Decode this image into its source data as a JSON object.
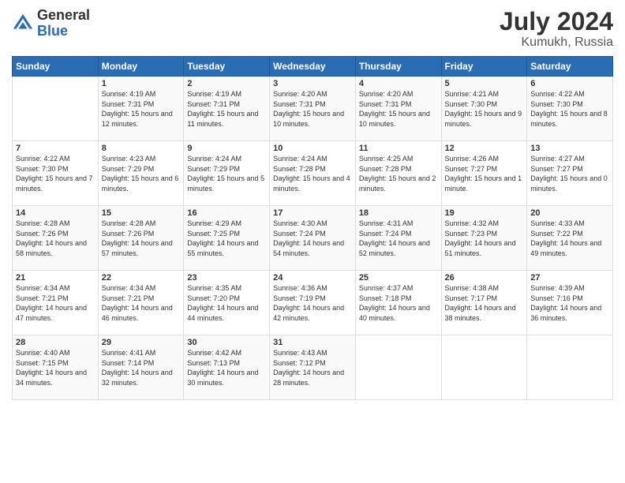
{
  "logo": {
    "general": "General",
    "blue": "Blue"
  },
  "title": {
    "month_year": "July 2024",
    "location": "Kumukh, Russia"
  },
  "headers": [
    "Sunday",
    "Monday",
    "Tuesday",
    "Wednesday",
    "Thursday",
    "Friday",
    "Saturday"
  ],
  "weeks": [
    [
      {
        "day": "",
        "sunrise": "",
        "sunset": "",
        "daylight": ""
      },
      {
        "day": "1",
        "sunrise": "Sunrise: 4:19 AM",
        "sunset": "Sunset: 7:31 PM",
        "daylight": "Daylight: 15 hours and 12 minutes."
      },
      {
        "day": "2",
        "sunrise": "Sunrise: 4:19 AM",
        "sunset": "Sunset: 7:31 PM",
        "daylight": "Daylight: 15 hours and 11 minutes."
      },
      {
        "day": "3",
        "sunrise": "Sunrise: 4:20 AM",
        "sunset": "Sunset: 7:31 PM",
        "daylight": "Daylight: 15 hours and 10 minutes."
      },
      {
        "day": "4",
        "sunrise": "Sunrise: 4:20 AM",
        "sunset": "Sunset: 7:31 PM",
        "daylight": "Daylight: 15 hours and 10 minutes."
      },
      {
        "day": "5",
        "sunrise": "Sunrise: 4:21 AM",
        "sunset": "Sunset: 7:30 PM",
        "daylight": "Daylight: 15 hours and 9 minutes."
      },
      {
        "day": "6",
        "sunrise": "Sunrise: 4:22 AM",
        "sunset": "Sunset: 7:30 PM",
        "daylight": "Daylight: 15 hours and 8 minutes."
      }
    ],
    [
      {
        "day": "7",
        "sunrise": "Sunrise: 4:22 AM",
        "sunset": "Sunset: 7:30 PM",
        "daylight": "Daylight: 15 hours and 7 minutes."
      },
      {
        "day": "8",
        "sunrise": "Sunrise: 4:23 AM",
        "sunset": "Sunset: 7:29 PM",
        "daylight": "Daylight: 15 hours and 6 minutes."
      },
      {
        "day": "9",
        "sunrise": "Sunrise: 4:24 AM",
        "sunset": "Sunset: 7:29 PM",
        "daylight": "Daylight: 15 hours and 5 minutes."
      },
      {
        "day": "10",
        "sunrise": "Sunrise: 4:24 AM",
        "sunset": "Sunset: 7:28 PM",
        "daylight": "Daylight: 15 hours and 4 minutes."
      },
      {
        "day": "11",
        "sunrise": "Sunrise: 4:25 AM",
        "sunset": "Sunset: 7:28 PM",
        "daylight": "Daylight: 15 hours and 2 minutes."
      },
      {
        "day": "12",
        "sunrise": "Sunrise: 4:26 AM",
        "sunset": "Sunset: 7:27 PM",
        "daylight": "Daylight: 15 hours and 1 minute."
      },
      {
        "day": "13",
        "sunrise": "Sunrise: 4:27 AM",
        "sunset": "Sunset: 7:27 PM",
        "daylight": "Daylight: 15 hours and 0 minutes."
      }
    ],
    [
      {
        "day": "14",
        "sunrise": "Sunrise: 4:28 AM",
        "sunset": "Sunset: 7:26 PM",
        "daylight": "Daylight: 14 hours and 58 minutes."
      },
      {
        "day": "15",
        "sunrise": "Sunrise: 4:28 AM",
        "sunset": "Sunset: 7:26 PM",
        "daylight": "Daylight: 14 hours and 57 minutes."
      },
      {
        "day": "16",
        "sunrise": "Sunrise: 4:29 AM",
        "sunset": "Sunset: 7:25 PM",
        "daylight": "Daylight: 14 hours and 55 minutes."
      },
      {
        "day": "17",
        "sunrise": "Sunrise: 4:30 AM",
        "sunset": "Sunset: 7:24 PM",
        "daylight": "Daylight: 14 hours and 54 minutes."
      },
      {
        "day": "18",
        "sunrise": "Sunrise: 4:31 AM",
        "sunset": "Sunset: 7:24 PM",
        "daylight": "Daylight: 14 hours and 52 minutes."
      },
      {
        "day": "19",
        "sunrise": "Sunrise: 4:32 AM",
        "sunset": "Sunset: 7:23 PM",
        "daylight": "Daylight: 14 hours and 51 minutes."
      },
      {
        "day": "20",
        "sunrise": "Sunrise: 4:33 AM",
        "sunset": "Sunset: 7:22 PM",
        "daylight": "Daylight: 14 hours and 49 minutes."
      }
    ],
    [
      {
        "day": "21",
        "sunrise": "Sunrise: 4:34 AM",
        "sunset": "Sunset: 7:21 PM",
        "daylight": "Daylight: 14 hours and 47 minutes."
      },
      {
        "day": "22",
        "sunrise": "Sunrise: 4:34 AM",
        "sunset": "Sunset: 7:21 PM",
        "daylight": "Daylight: 14 hours and 46 minutes."
      },
      {
        "day": "23",
        "sunrise": "Sunrise: 4:35 AM",
        "sunset": "Sunset: 7:20 PM",
        "daylight": "Daylight: 14 hours and 44 minutes."
      },
      {
        "day": "24",
        "sunrise": "Sunrise: 4:36 AM",
        "sunset": "Sunset: 7:19 PM",
        "daylight": "Daylight: 14 hours and 42 minutes."
      },
      {
        "day": "25",
        "sunrise": "Sunrise: 4:37 AM",
        "sunset": "Sunset: 7:18 PM",
        "daylight": "Daylight: 14 hours and 40 minutes."
      },
      {
        "day": "26",
        "sunrise": "Sunrise: 4:38 AM",
        "sunset": "Sunset: 7:17 PM",
        "daylight": "Daylight: 14 hours and 38 minutes."
      },
      {
        "day": "27",
        "sunrise": "Sunrise: 4:39 AM",
        "sunset": "Sunset: 7:16 PM",
        "daylight": "Daylight: 14 hours and 36 minutes."
      }
    ],
    [
      {
        "day": "28",
        "sunrise": "Sunrise: 4:40 AM",
        "sunset": "Sunset: 7:15 PM",
        "daylight": "Daylight: 14 hours and 34 minutes."
      },
      {
        "day": "29",
        "sunrise": "Sunrise: 4:41 AM",
        "sunset": "Sunset: 7:14 PM",
        "daylight": "Daylight: 14 hours and 32 minutes."
      },
      {
        "day": "30",
        "sunrise": "Sunrise: 4:42 AM",
        "sunset": "Sunset: 7:13 PM",
        "daylight": "Daylight: 14 hours and 30 minutes."
      },
      {
        "day": "31",
        "sunrise": "Sunrise: 4:43 AM",
        "sunset": "Sunset: 7:12 PM",
        "daylight": "Daylight: 14 hours and 28 minutes."
      },
      {
        "day": "",
        "sunrise": "",
        "sunset": "",
        "daylight": ""
      },
      {
        "day": "",
        "sunrise": "",
        "sunset": "",
        "daylight": ""
      },
      {
        "day": "",
        "sunrise": "",
        "sunset": "",
        "daylight": ""
      }
    ]
  ]
}
